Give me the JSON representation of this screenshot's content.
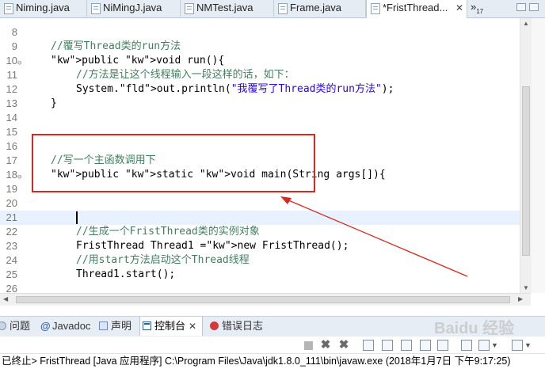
{
  "editor_tabs": [
    {
      "label": "Niming.java",
      "active": false
    },
    {
      "label": "NiMingJ.java",
      "active": false
    },
    {
      "label": "NMTest.java",
      "active": false
    },
    {
      "label": "Frame.java",
      "active": false
    },
    {
      "label": "*FristThread...",
      "active": true
    }
  ],
  "tab_overflow": {
    "symbol": "»",
    "count": "17"
  },
  "code_lines": [
    {
      "num": "8",
      "text": ""
    },
    {
      "num": "9",
      "text": "//覆写Thread类的run方法"
    },
    {
      "num": "10",
      "text": "public void run(){"
    },
    {
      "num": "11",
      "text": "//方法是让这个线程输入一段这样的话，如下："
    },
    {
      "num": "12",
      "text": "System.out.println(\"我覆写了Thread类的run方法\");"
    },
    {
      "num": "13",
      "text": "}"
    },
    {
      "num": "14",
      "text": ""
    },
    {
      "num": "15",
      "text": ""
    },
    {
      "num": "16",
      "text": ""
    },
    {
      "num": "17",
      "text": "//写一个主函数调用下"
    },
    {
      "num": "18",
      "text": "public static void main(String args[]){"
    },
    {
      "num": "19",
      "text": ""
    },
    {
      "num": "20",
      "text": ""
    },
    {
      "num": "21",
      "text": ""
    },
    {
      "num": "22",
      "text": "//生成一个FristThread类的实例对象"
    },
    {
      "num": "23",
      "text": "FristThread Thread1 =new FristThread();"
    },
    {
      "num": "24",
      "text": "//用start方法启动这个Thread线程"
    },
    {
      "num": "25",
      "text": "Thread1.start();"
    },
    {
      "num": "26",
      "text": ""
    }
  ],
  "view_tabs": [
    {
      "label": "问题",
      "icon": "problems-icon"
    },
    {
      "label": "Javadoc",
      "icon": "javadoc-icon"
    },
    {
      "label": "声明",
      "icon": "declaration-icon"
    },
    {
      "label": "控制台",
      "icon": "console-icon",
      "active": true
    },
    {
      "label": "错误日志",
      "icon": "error-log-icon"
    }
  ],
  "console_status": "已终止> FristThread [Java 应用程序] C:\\Program Files\\Java\\jdk1.8.0_111\\bin\\javaw.exe (2018年1月7日 下午9:17:25)",
  "watermark": "Baidu 经验",
  "colors": {
    "keyword": "#7f0055",
    "comment": "#3f7f5f",
    "string": "#2a00ff",
    "annotation": "#d9281f",
    "current_line": "#e8f2fe"
  }
}
